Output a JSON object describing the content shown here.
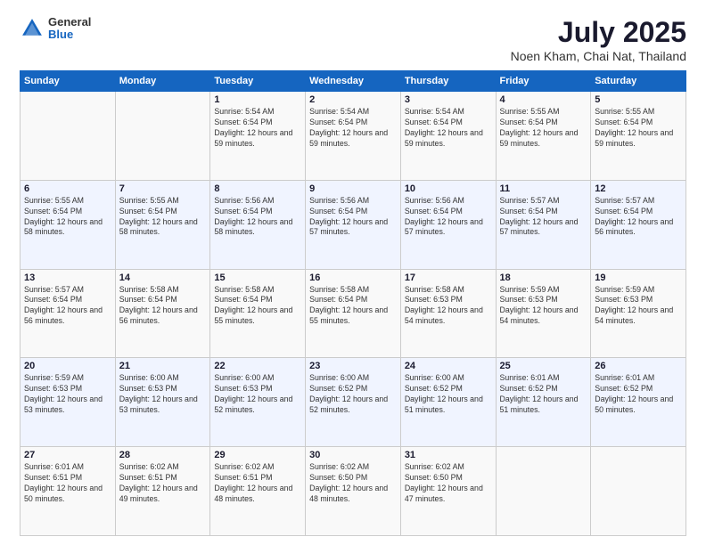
{
  "logo": {
    "general": "General",
    "blue": "Blue"
  },
  "header": {
    "title": "July 2025",
    "subtitle": "Noen Kham, Chai Nat, Thailand"
  },
  "days_of_week": [
    "Sunday",
    "Monday",
    "Tuesday",
    "Wednesday",
    "Thursday",
    "Friday",
    "Saturday"
  ],
  "weeks": [
    [
      {
        "day": "",
        "info": ""
      },
      {
        "day": "",
        "info": ""
      },
      {
        "day": "1",
        "info": "Sunrise: 5:54 AM\nSunset: 6:54 PM\nDaylight: 12 hours and 59 minutes."
      },
      {
        "day": "2",
        "info": "Sunrise: 5:54 AM\nSunset: 6:54 PM\nDaylight: 12 hours and 59 minutes."
      },
      {
        "day": "3",
        "info": "Sunrise: 5:54 AM\nSunset: 6:54 PM\nDaylight: 12 hours and 59 minutes."
      },
      {
        "day": "4",
        "info": "Sunrise: 5:55 AM\nSunset: 6:54 PM\nDaylight: 12 hours and 59 minutes."
      },
      {
        "day": "5",
        "info": "Sunrise: 5:55 AM\nSunset: 6:54 PM\nDaylight: 12 hours and 59 minutes."
      }
    ],
    [
      {
        "day": "6",
        "info": "Sunrise: 5:55 AM\nSunset: 6:54 PM\nDaylight: 12 hours and 58 minutes."
      },
      {
        "day": "7",
        "info": "Sunrise: 5:55 AM\nSunset: 6:54 PM\nDaylight: 12 hours and 58 minutes."
      },
      {
        "day": "8",
        "info": "Sunrise: 5:56 AM\nSunset: 6:54 PM\nDaylight: 12 hours and 58 minutes."
      },
      {
        "day": "9",
        "info": "Sunrise: 5:56 AM\nSunset: 6:54 PM\nDaylight: 12 hours and 57 minutes."
      },
      {
        "day": "10",
        "info": "Sunrise: 5:56 AM\nSunset: 6:54 PM\nDaylight: 12 hours and 57 minutes."
      },
      {
        "day": "11",
        "info": "Sunrise: 5:57 AM\nSunset: 6:54 PM\nDaylight: 12 hours and 57 minutes."
      },
      {
        "day": "12",
        "info": "Sunrise: 5:57 AM\nSunset: 6:54 PM\nDaylight: 12 hours and 56 minutes."
      }
    ],
    [
      {
        "day": "13",
        "info": "Sunrise: 5:57 AM\nSunset: 6:54 PM\nDaylight: 12 hours and 56 minutes."
      },
      {
        "day": "14",
        "info": "Sunrise: 5:58 AM\nSunset: 6:54 PM\nDaylight: 12 hours and 56 minutes."
      },
      {
        "day": "15",
        "info": "Sunrise: 5:58 AM\nSunset: 6:54 PM\nDaylight: 12 hours and 55 minutes."
      },
      {
        "day": "16",
        "info": "Sunrise: 5:58 AM\nSunset: 6:54 PM\nDaylight: 12 hours and 55 minutes."
      },
      {
        "day": "17",
        "info": "Sunrise: 5:58 AM\nSunset: 6:53 PM\nDaylight: 12 hours and 54 minutes."
      },
      {
        "day": "18",
        "info": "Sunrise: 5:59 AM\nSunset: 6:53 PM\nDaylight: 12 hours and 54 minutes."
      },
      {
        "day": "19",
        "info": "Sunrise: 5:59 AM\nSunset: 6:53 PM\nDaylight: 12 hours and 54 minutes."
      }
    ],
    [
      {
        "day": "20",
        "info": "Sunrise: 5:59 AM\nSunset: 6:53 PM\nDaylight: 12 hours and 53 minutes."
      },
      {
        "day": "21",
        "info": "Sunrise: 6:00 AM\nSunset: 6:53 PM\nDaylight: 12 hours and 53 minutes."
      },
      {
        "day": "22",
        "info": "Sunrise: 6:00 AM\nSunset: 6:53 PM\nDaylight: 12 hours and 52 minutes."
      },
      {
        "day": "23",
        "info": "Sunrise: 6:00 AM\nSunset: 6:52 PM\nDaylight: 12 hours and 52 minutes."
      },
      {
        "day": "24",
        "info": "Sunrise: 6:00 AM\nSunset: 6:52 PM\nDaylight: 12 hours and 51 minutes."
      },
      {
        "day": "25",
        "info": "Sunrise: 6:01 AM\nSunset: 6:52 PM\nDaylight: 12 hours and 51 minutes."
      },
      {
        "day": "26",
        "info": "Sunrise: 6:01 AM\nSunset: 6:52 PM\nDaylight: 12 hours and 50 minutes."
      }
    ],
    [
      {
        "day": "27",
        "info": "Sunrise: 6:01 AM\nSunset: 6:51 PM\nDaylight: 12 hours and 50 minutes."
      },
      {
        "day": "28",
        "info": "Sunrise: 6:02 AM\nSunset: 6:51 PM\nDaylight: 12 hours and 49 minutes."
      },
      {
        "day": "29",
        "info": "Sunrise: 6:02 AM\nSunset: 6:51 PM\nDaylight: 12 hours and 48 minutes."
      },
      {
        "day": "30",
        "info": "Sunrise: 6:02 AM\nSunset: 6:50 PM\nDaylight: 12 hours and 48 minutes."
      },
      {
        "day": "31",
        "info": "Sunrise: 6:02 AM\nSunset: 6:50 PM\nDaylight: 12 hours and 47 minutes."
      },
      {
        "day": "",
        "info": ""
      },
      {
        "day": "",
        "info": ""
      }
    ]
  ]
}
